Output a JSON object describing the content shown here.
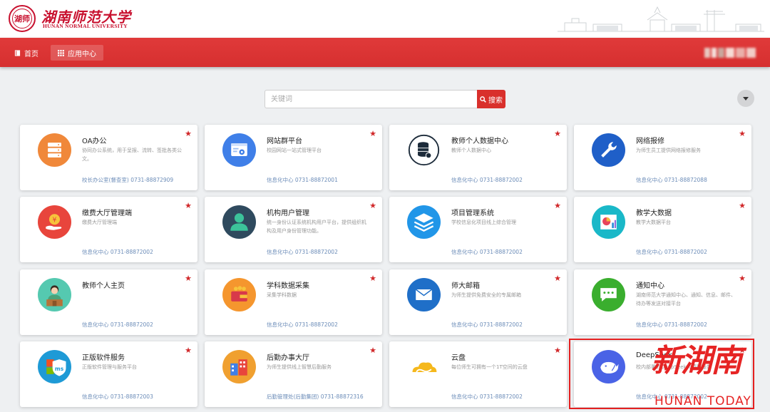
{
  "header": {
    "school_name_cn": "湖南师范大学",
    "school_name_en": "HUNAN NORMAL UNIVERSITY",
    "logo_text": "湖师"
  },
  "nav": {
    "home_label": "首页",
    "apps_label": "应用中心"
  },
  "search": {
    "placeholder": "关键词",
    "button_label": "搜索"
  },
  "colors": {
    "brand_red": "#d62f2f",
    "star": "#d1282a",
    "contact": "#6b8cb8"
  },
  "apps": [
    {
      "title": "OA办公",
      "desc": "协同办公系统，用于呈报、流转、签批各类公文。",
      "contact": "校长办公室(督查室) 0731-88872909",
      "icon": "server-icon",
      "color": "#f0883a"
    },
    {
      "title": "网站群平台",
      "desc": "校园网站一站式管理平台",
      "contact": "信息化中心 0731-88872001",
      "icon": "website-settings-icon",
      "color": "#3f7fe8"
    },
    {
      "title": "教师个人数据中心",
      "desc": "教师个人数据中心",
      "contact": "信息化中心 0731-88872002",
      "icon": "database-icon",
      "color": "#ffffff"
    },
    {
      "title": "网络报修",
      "desc": "为师生员工提供网络报修服务",
      "contact": "信息化中心 0731-88872088",
      "icon": "wrench-icon",
      "color": "#1f5fc8"
    },
    {
      "title": "缴费大厅管理端",
      "desc": "缴费大厅管理端",
      "contact": "信息化中心 0731-88872002",
      "icon": "payment-hand-icon",
      "color": "#e8453c"
    },
    {
      "title": "机构用户管理",
      "desc": "统一身份认证系统机构用户平台，提供组织机构及用户身份管理功能。",
      "contact": "信息化中心 0731-88872002",
      "icon": "user-icon",
      "color": "#2f4a5e"
    },
    {
      "title": "项目管理系统",
      "desc": "学校信息化项目线上综合管理",
      "contact": "信息化中心 0731-88872002",
      "icon": "layers-icon",
      "color": "#2196e8"
    },
    {
      "title": "教学大数据",
      "desc": "教学大数据平台",
      "contact": "信息化中心 0731-88872002",
      "icon": "chart-icon",
      "color": "#1ab8c8"
    },
    {
      "title": "教师个人主页",
      "desc": "",
      "contact": "信息化中心 0731-88872002",
      "icon": "teacher-icon",
      "color": "#55c9b0"
    },
    {
      "title": "学科数据采集",
      "desc": "采集学科数据",
      "contact": "信息化中心 0731-88872002",
      "icon": "wallet-icon",
      "color": "#f5962e"
    },
    {
      "title": "师大邮箱",
      "desc": "为师生提供免费安全的专属邮箱",
      "contact": "信息化中心 0731-88872002",
      "icon": "mail-icon",
      "color": "#1f6fc8"
    },
    {
      "title": "通知中心",
      "desc": "湖南师范大学通知中心、通知、信息、邮件、待办等发送对接平台",
      "contact": "信息化中心 0731-88872002",
      "icon": "message-icon",
      "color": "#3aae2e"
    },
    {
      "title": "正版软件服务",
      "desc": "正版软件管理与服务平台",
      "contact": "信息化中心 0731-88872003",
      "icon": "ms-shield-icon",
      "color": "#1e9ad6"
    },
    {
      "title": "后勤办事大厅",
      "desc": "为师生提供线上智慧后勤服务",
      "contact": "后勤管理处(后勤集团) 0731-88872316",
      "icon": "building-icon",
      "color": "#f0a030"
    },
    {
      "title": "云盘",
      "desc": "每位师生可拥有一个1T空间的云盘",
      "contact": "信息化中心 0731-88872002",
      "icon": "cloud-icon",
      "color": "#ffffff"
    },
    {
      "title": "DeepSeek",
      "desc": "校内部署的DeepSeek大模型服务",
      "contact": "信息化中心 0731-88872002",
      "icon": "whale-icon",
      "color": "#4a63e6"
    }
  ],
  "watermark": {
    "cn": "新湖南",
    "en": "HUNAN TODAY"
  }
}
